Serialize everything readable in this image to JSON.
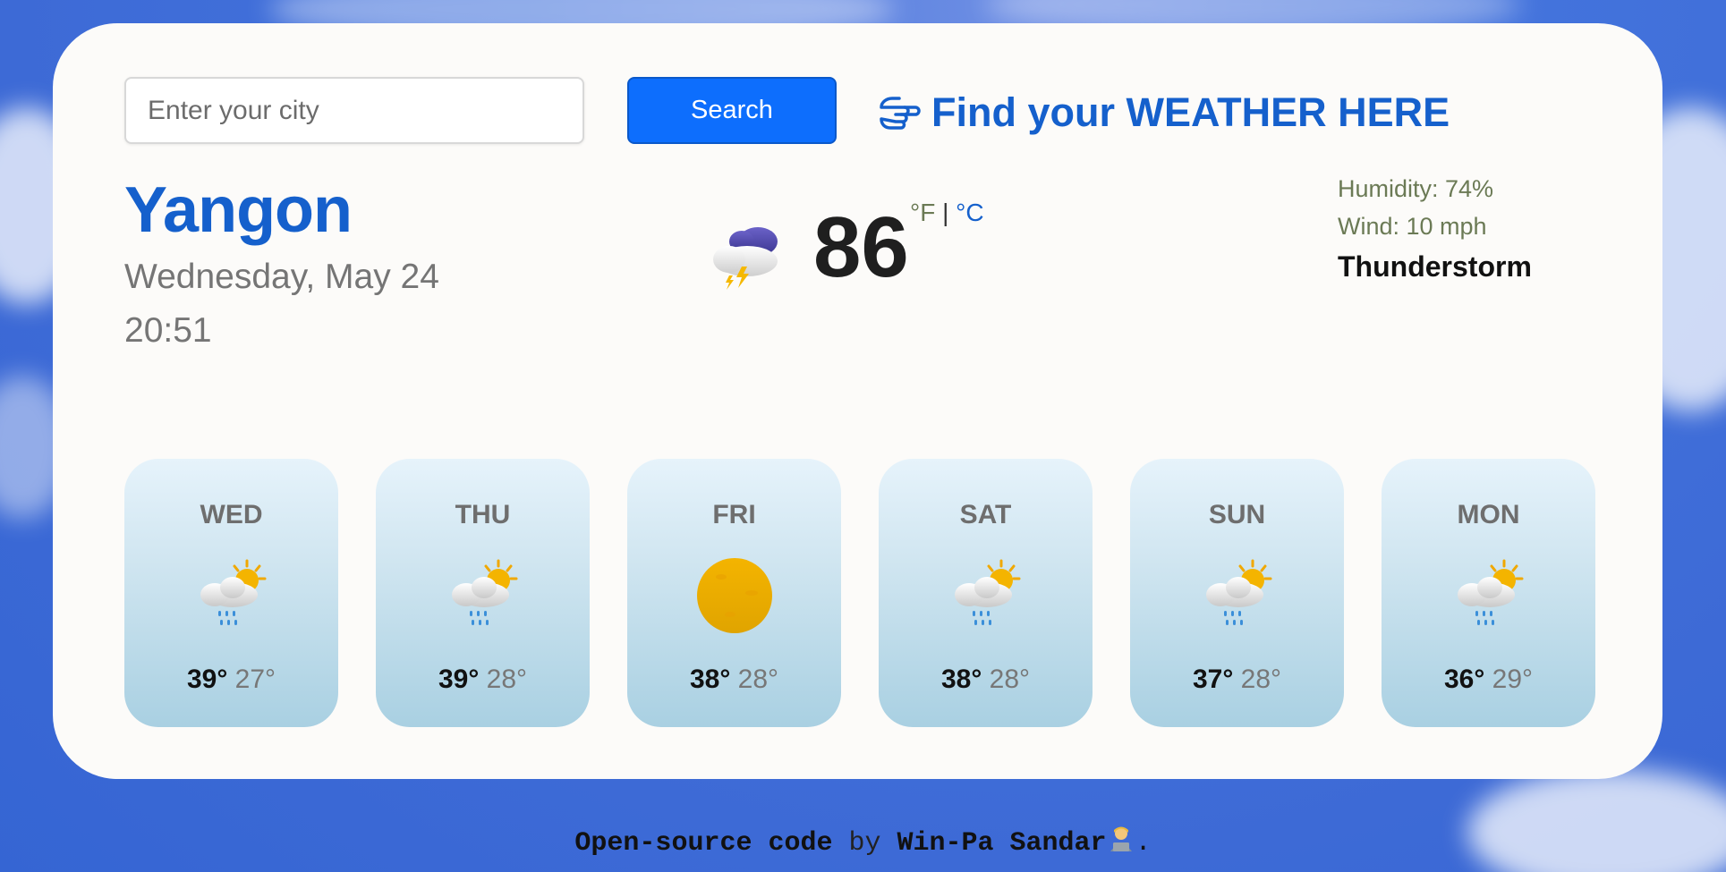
{
  "search": {
    "placeholder": "Enter your city",
    "button_label": "Search"
  },
  "tagline": {
    "text": "Find your WEATHER HERE",
    "icon": "pointing-hand-icon"
  },
  "current": {
    "city": "Yangon",
    "date": "Wednesday, May 24",
    "time": "20:51",
    "temperature": "86",
    "unit_f": "°F",
    "unit_separator": "|",
    "unit_c": "°C",
    "icon": "thunderstorm-icon",
    "humidity": "Humidity: 74%",
    "wind": "Wind: 10 mph",
    "condition": "Thunderstorm"
  },
  "forecast": [
    {
      "day": "WED",
      "max": "39°",
      "min": "27°",
      "icon": "sun-rain-cloud-icon"
    },
    {
      "day": "THU",
      "max": "39°",
      "min": "28°",
      "icon": "sun-rain-cloud-icon"
    },
    {
      "day": "FRI",
      "max": "38°",
      "min": "28°",
      "icon": "sun-icon"
    },
    {
      "day": "SAT",
      "max": "38°",
      "min": "28°",
      "icon": "sun-rain-cloud-icon"
    },
    {
      "day": "SUN",
      "max": "37°",
      "min": "28°",
      "icon": "sun-rain-cloud-icon"
    },
    {
      "day": "MON",
      "max": "36°",
      "min": "29°",
      "icon": "sun-rain-cloud-icon"
    }
  ],
  "footer": {
    "link_text": "Open-source code",
    "by": "by",
    "author": "Win-Pa Sandar",
    "end": "."
  },
  "colors": {
    "accent": "#1560cc",
    "button": "#0d6efd",
    "card": "#fcfbf9",
    "background": "#3f6fd8"
  }
}
